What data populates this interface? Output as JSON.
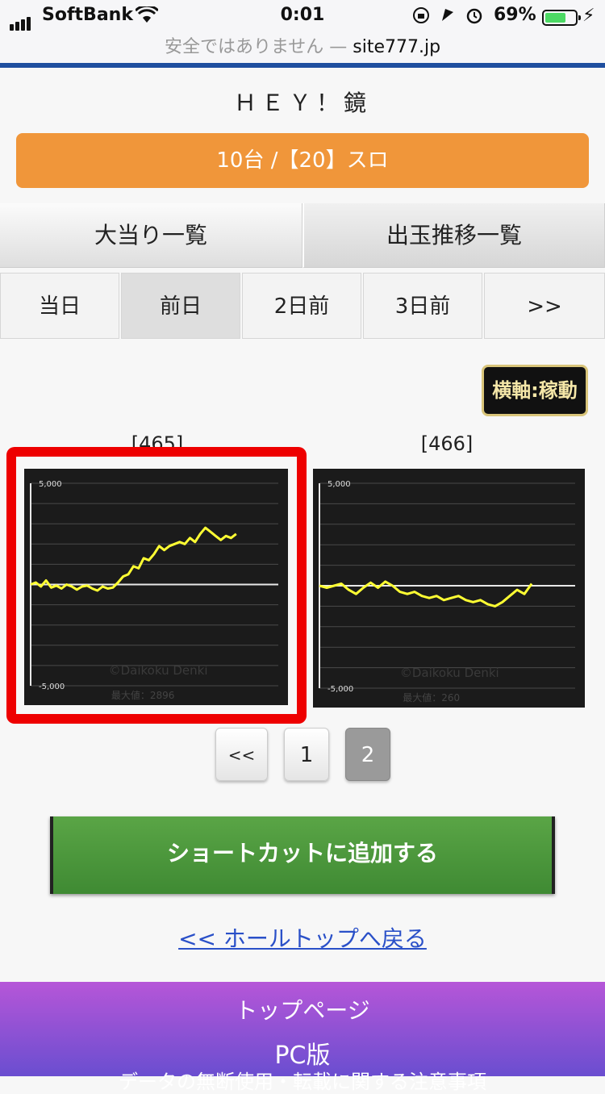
{
  "status_bar": {
    "carrier": "SoftBank",
    "time": "0:01",
    "battery_percent": "69%",
    "battery_level": 0.69,
    "url_warning": "安全ではありません — ",
    "url_domain": "site777.jp"
  },
  "hall_title": "ＨＥＹ！鏡",
  "machine_bar": "10台 /【20】スロ",
  "tabs": [
    "大当り一覧",
    "出玉推移一覧"
  ],
  "days": [
    "当日",
    "前日",
    "2日前",
    "3日前",
    ">>"
  ],
  "active_day": "前日",
  "axis_toggle": "横軸:稼動",
  "charts": [
    {
      "label": "[465]",
      "max_text": "最大値：2896",
      "y_top": "5,000",
      "y_bottom": "-5,000",
      "watermark": "©Daikoku Denki",
      "highlighted": true
    },
    {
      "label": "[466]",
      "max_text": "最大値：260",
      "y_top": "5,000",
      "y_bottom": "-5,000",
      "watermark": "©Daikoku Denki",
      "highlighted": false
    }
  ],
  "chart_data": [
    {
      "type": "line",
      "title": "[465]",
      "ylim": [
        -5000,
        5000
      ],
      "y_tick_labels": [
        "5,000",
        "-5,000"
      ],
      "series": [
        {
          "values": [
            0,
            100,
            -100,
            200,
            -150,
            -50,
            -200,
            0,
            -100,
            -250,
            -100,
            -50,
            -200,
            -300,
            -100,
            -200,
            -150,
            100,
            400,
            500,
            900,
            800,
            1300,
            1200,
            1500,
            1900,
            1700,
            1900,
            2000,
            2100,
            2000,
            2300,
            2100,
            2500,
            2800,
            2600,
            2400,
            2200,
            2400,
            2300,
            2500
          ]
        }
      ],
      "max_value": 2896,
      "line_color": "#ffff33",
      "background": "#1b1b1b"
    },
    {
      "type": "line",
      "title": "[466]",
      "ylim": [
        -5000,
        5000
      ],
      "y_tick_labels": [
        "5,000",
        "-5,000"
      ],
      "series": [
        {
          "values": [
            0,
            -100,
            0,
            100,
            -200,
            -400,
            -100,
            150,
            -100,
            200,
            0,
            -300,
            -400,
            -300,
            -500,
            -600,
            -500,
            -700,
            -600,
            -500,
            -700,
            -800,
            -700,
            -900,
            -1000,
            -800,
            -500,
            -200,
            -400,
            100
          ]
        }
      ],
      "max_value": 260,
      "line_color": "#ffff33",
      "background": "#1b1b1b"
    }
  ],
  "pager": {
    "prev": "<<",
    "pages": [
      "1",
      "2"
    ],
    "current": "2"
  },
  "shortcut_button": "ショートカットに追加する",
  "back_link": "<< ホールトップへ戻る",
  "footer": {
    "top_page": "トップページ",
    "pc_version": "PC版",
    "notice": "データの無断使用・転載に関する注意事項"
  }
}
